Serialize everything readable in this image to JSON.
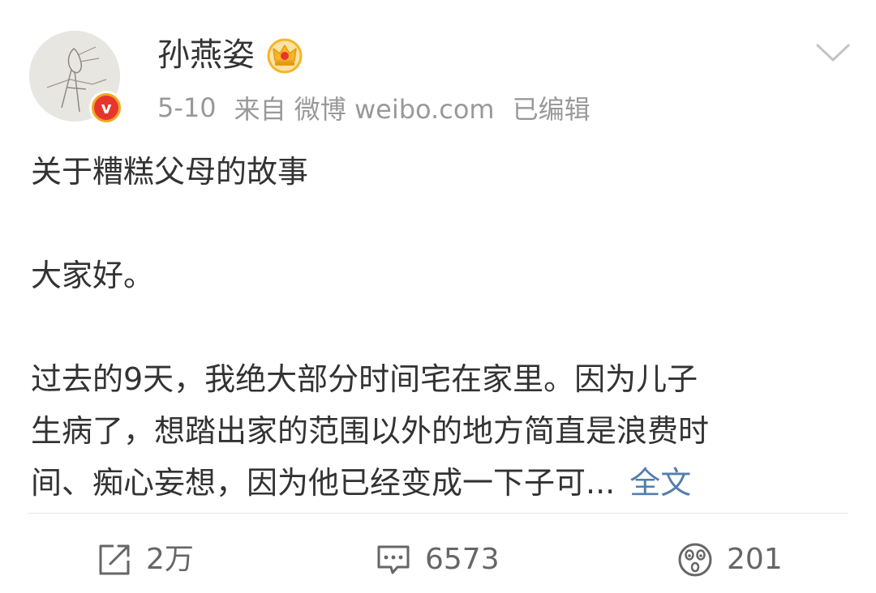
{
  "user": {
    "name": "孙燕姿",
    "avatar_icon": "avatar-sketch-drawing",
    "verified_icon": "verified-v-badge",
    "verified_letter": "v",
    "vip_icon": "crown-icon"
  },
  "meta": {
    "date": "5-10",
    "source": "来自 微博 weibo.com",
    "edited": "已编辑"
  },
  "content": {
    "title": "关于糟糕父母的故事",
    "greeting": "大家好。",
    "body_lines": [
      "过去的9天，我绝大部分时间宅在家里。因为儿子",
      "生病了，想踏出家的范围以外的地方简直是浪费时",
      "间、痴心妄想，因为他已经变成一下子可..."
    ],
    "more_label": "全文"
  },
  "actions": {
    "repost_count": "2万",
    "comment_count": "6573",
    "like_count": "201"
  },
  "colors": {
    "text": "#333333",
    "meta": "#999999",
    "link": "#537eac",
    "badge_orange": "#f2a623",
    "badge_red": "#e8352c",
    "crown": "#f5b529"
  }
}
